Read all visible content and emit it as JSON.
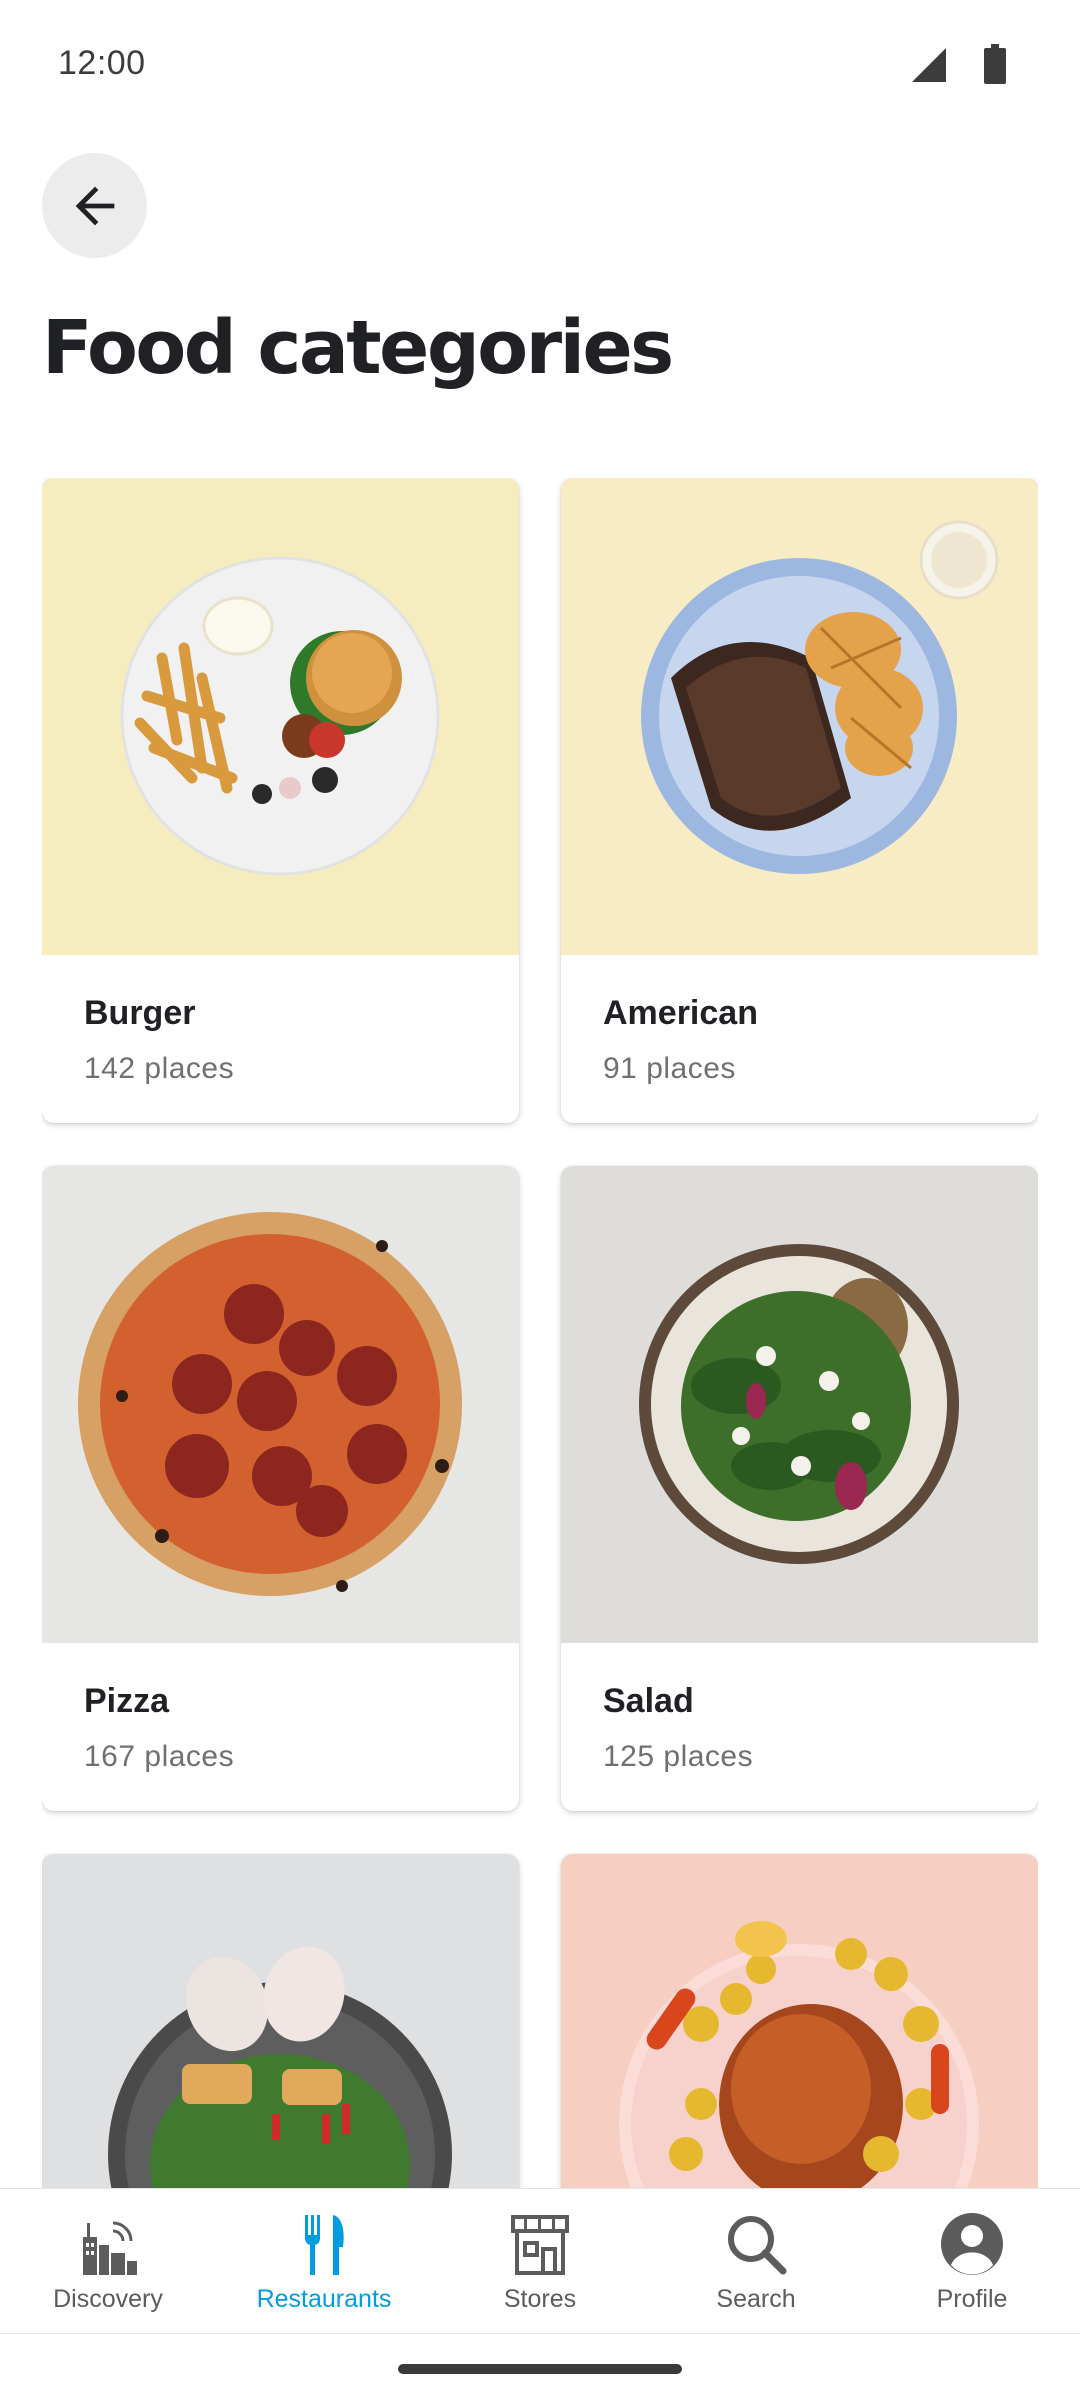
{
  "status_bar": {
    "time": "12:00"
  },
  "page": {
    "title": "Food categories"
  },
  "categories": [
    {
      "name": "Burger",
      "count": "142 places"
    },
    {
      "name": "American",
      "count": "91 places"
    },
    {
      "name": "Pizza",
      "count": "167 places"
    },
    {
      "name": "Salad",
      "count": "125 places"
    },
    {
      "name": "",
      "count": ""
    },
    {
      "name": "",
      "count": ""
    }
  ],
  "bottom_nav": {
    "items": [
      {
        "label": "Discovery",
        "icon": "city-icon",
        "active": false
      },
      {
        "label": "Restaurants",
        "icon": "fork-knife-icon",
        "active": true
      },
      {
        "label": "Stores",
        "icon": "store-icon",
        "active": false
      },
      {
        "label": "Search",
        "icon": "search-icon",
        "active": false
      },
      {
        "label": "Profile",
        "icon": "profile-icon",
        "active": false
      }
    ]
  },
  "colors": {
    "accent": "#009de0",
    "text": "#202125",
    "muted": "#707070"
  }
}
